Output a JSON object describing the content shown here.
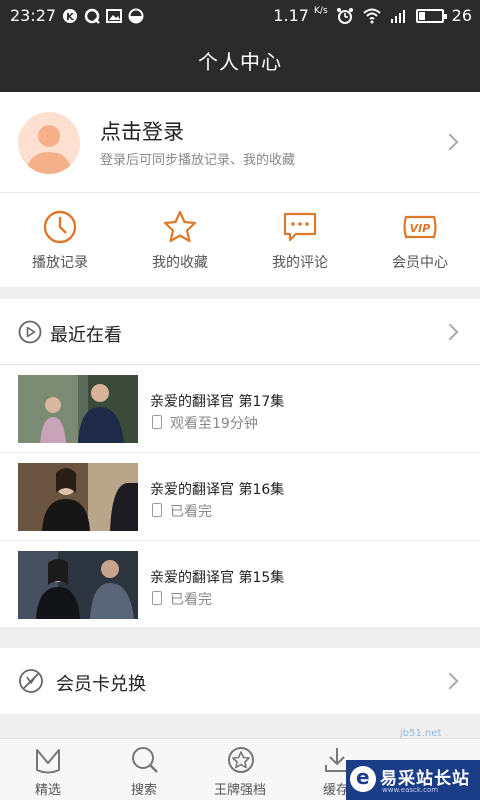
{
  "status_bar": {
    "time": "23:27",
    "speed": "1.17",
    "speed_unit": "K/s",
    "battery": "26",
    "battery_level": 0.26
  },
  "header": {
    "title": "个人中心"
  },
  "login": {
    "title": "点击登录",
    "subtitle": "登录后可同步播放记录、我的收藏"
  },
  "quick_actions": [
    {
      "label": "播放记录",
      "icon": "clock-icon"
    },
    {
      "label": "我的收藏",
      "icon": "star-icon"
    },
    {
      "label": "我的评论",
      "icon": "comment-icon"
    },
    {
      "label": "会员中心",
      "icon": "vip-icon"
    }
  ],
  "accent_color": "#e0782a",
  "recent": {
    "title": "最近在看",
    "items": [
      {
        "name": "亲爱的翻译官 第17集",
        "progress": "观看至19分钟"
      },
      {
        "name": "亲爱的翻译官 第16集",
        "progress": "已看完"
      },
      {
        "name": "亲爱的翻译官 第15集",
        "progress": "已看完"
      }
    ]
  },
  "vip_exchange": {
    "title": "会员卡兑换"
  },
  "bottom_nav": [
    {
      "label": "精选",
      "icon": "featured-icon"
    },
    {
      "label": "搜索",
      "icon": "search-icon"
    },
    {
      "label": "王牌强档",
      "icon": "star-badge-icon"
    },
    {
      "label": "缓存",
      "icon": "download-icon"
    }
  ],
  "watermark": {
    "brand": "易采站长站",
    "url": "www.easck.com",
    "top_text": "jb51.net"
  }
}
